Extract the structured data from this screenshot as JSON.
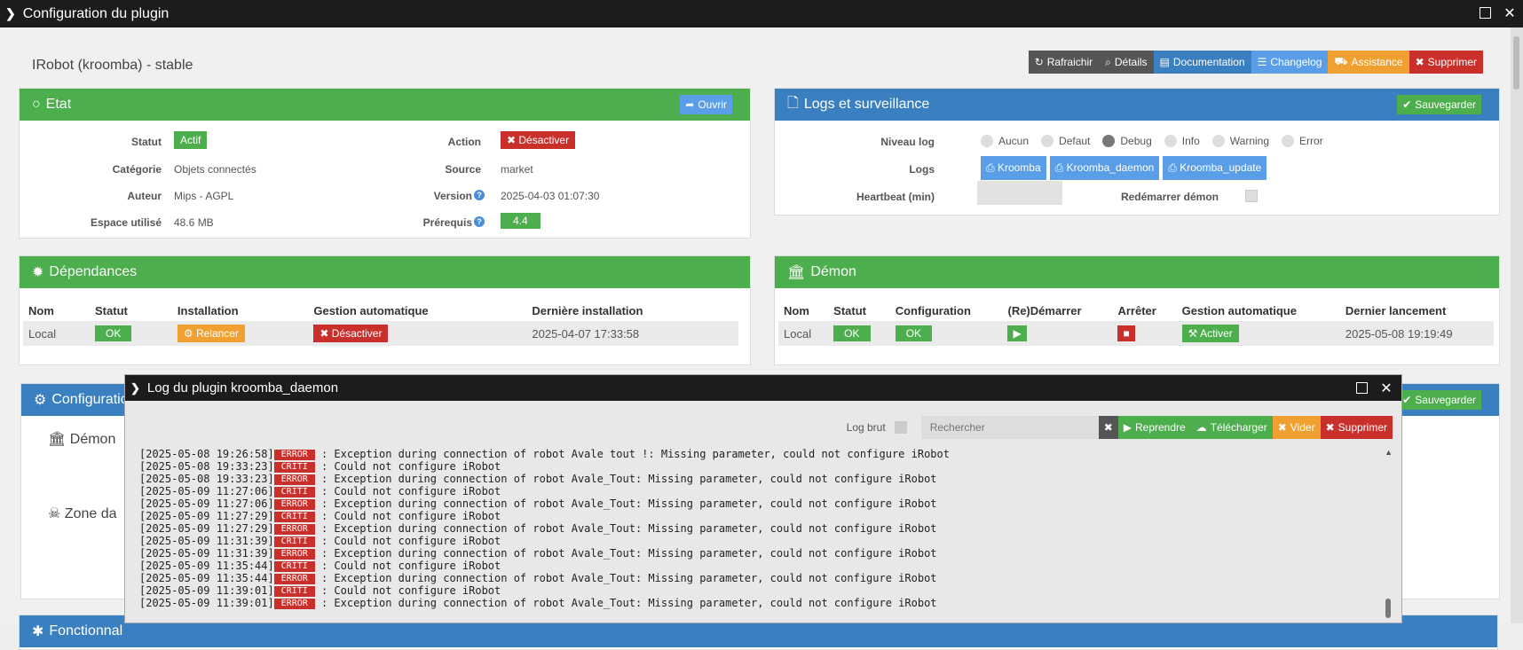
{
  "window": {
    "title": "Configuration du plugin"
  },
  "plugin_name": "IRobot (kroomba) - stable",
  "topbar": [
    {
      "label": "Rafraichir",
      "icon": "refresh-icon",
      "color": "#555555"
    },
    {
      "label": "Détails",
      "icon": "search-icon",
      "color": "#555555"
    },
    {
      "label": "Documentation",
      "icon": "book-icon",
      "color": "#3a7fbf"
    },
    {
      "label": "Changelog",
      "icon": "file-icon",
      "color": "#5a9ee8"
    },
    {
      "label": "Assistance",
      "icon": "ambulance-icon",
      "color": "#f0a030"
    },
    {
      "label": "Supprimer",
      "icon": "trash-icon",
      "color": "#c9302c"
    }
  ],
  "etat": {
    "title": "Etat",
    "open_btn": "Ouvrir",
    "statut_label": "Statut",
    "statut_value": "Actif",
    "categorie_label": "Catégorie",
    "categorie_value": "Objets connectés",
    "auteur_label": "Auteur",
    "auteur_value": "Mips - AGPL",
    "espace_label": "Espace utilisé",
    "espace_value": "48.6 MB",
    "action_label": "Action",
    "action_value": "Désactiver",
    "source_label": "Source",
    "source_value": "market",
    "version_label": "Version",
    "version_value": "2025-04-03 01:07:30",
    "prerequis_label": "Prérequis",
    "prerequis_value": "4.4"
  },
  "logs_panel": {
    "title": "Logs et surveillance",
    "save_btn": "Sauvegarder",
    "niveau_label": "Niveau log",
    "levels": [
      "Aucun",
      "Defaut",
      "Debug",
      "Info",
      "Warning",
      "Error"
    ],
    "selected_level": "Debug",
    "logs_label": "Logs",
    "log_buttons": [
      "Kroomba",
      "Kroomba_daemon",
      "Kroomba_update"
    ],
    "heartbeat_label": "Heartbeat (min)",
    "redemarrer_label": "Redémarrer démon"
  },
  "dependances": {
    "title": "Dépendances",
    "headers": [
      "Nom",
      "Statut",
      "Installation",
      "Gestion automatique",
      "Dernière installation"
    ],
    "row": {
      "nom": "Local",
      "statut": "OK",
      "installation": "Relancer",
      "gestion": "Désactiver",
      "derniere": "2025-04-07 17:33:58"
    }
  },
  "demon": {
    "title": "Démon",
    "headers": [
      "Nom",
      "Statut",
      "Configuration",
      "(Re)Démarrer",
      "Arrêter",
      "Gestion automatique",
      "Dernier lancement"
    ],
    "row": {
      "nom": "Local",
      "statut": "OK",
      "configuration": "OK",
      "gestion": "Activer",
      "dernier": "2025-05-08 19:19:49"
    }
  },
  "config_panel": {
    "title": "Configuration",
    "save_btn": "Sauvegarder",
    "item1": "Démon",
    "item2": "Zone da"
  },
  "fonction_panel": {
    "title": "Fonctionnal"
  },
  "log_modal": {
    "title": "Log du plugin kroomba_daemon",
    "log_brut": "Log brut",
    "search_placeholder": "Rechercher",
    "buttons": [
      {
        "label": "Reprendre",
        "icon": "play-icon",
        "color": "#4cae4c"
      },
      {
        "label": "Télécharger",
        "icon": "cloud-download-icon",
        "color": "#4cae4c"
      },
      {
        "label": "Vider",
        "icon": "times-icon",
        "color": "#f0a030"
      },
      {
        "label": "Supprimer",
        "icon": "trash-icon",
        "color": "#c9302c"
      }
    ],
    "lines": [
      {
        "ts": "[2025-05-08 19:26:58]",
        "lvl": "ERROR",
        "msg": ": Exception during connection of robot Avale tout !: Missing parameter, could not configure iRobot"
      },
      {
        "ts": "[2025-05-08 19:33:23]",
        "lvl": "CRITI",
        "msg": ": Could not configure iRobot"
      },
      {
        "ts": "[2025-05-08 19:33:23]",
        "lvl": "ERROR",
        "msg": ": Exception during connection of robot Avale_Tout: Missing parameter, could not configure iRobot"
      },
      {
        "ts": "[2025-05-09 11:27:06]",
        "lvl": "CRITI",
        "msg": ": Could not configure iRobot"
      },
      {
        "ts": "[2025-05-09 11:27:06]",
        "lvl": "ERROR",
        "msg": ": Exception during connection of robot Avale_Tout: Missing parameter, could not configure iRobot"
      },
      {
        "ts": "[2025-05-09 11:27:29]",
        "lvl": "CRITI",
        "msg": ": Could not configure iRobot"
      },
      {
        "ts": "[2025-05-09 11:27:29]",
        "lvl": "ERROR",
        "msg": ": Exception during connection of robot Avale_Tout: Missing parameter, could not configure iRobot"
      },
      {
        "ts": "[2025-05-09 11:31:39]",
        "lvl": "CRITI",
        "msg": ": Could not configure iRobot"
      },
      {
        "ts": "[2025-05-09 11:31:39]",
        "lvl": "ERROR",
        "msg": ": Exception during connection of robot Avale_Tout: Missing parameter, could not configure iRobot"
      },
      {
        "ts": "[2025-05-09 11:35:44]",
        "lvl": "CRITI",
        "msg": ": Could not configure iRobot"
      },
      {
        "ts": "[2025-05-09 11:35:44]",
        "lvl": "ERROR",
        "msg": ": Exception during connection of robot Avale_Tout: Missing parameter, could not configure iRobot"
      },
      {
        "ts": "[2025-05-09 11:39:01]",
        "lvl": "CRITI",
        "msg": ": Could not configure iRobot"
      },
      {
        "ts": "[2025-05-09 11:39:01]",
        "lvl": "ERROR",
        "msg": ": Exception during connection of robot Avale_Tout: Missing parameter, could not configure iRobot"
      }
    ]
  }
}
